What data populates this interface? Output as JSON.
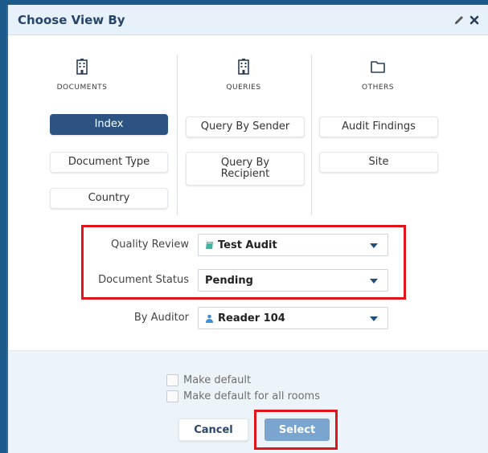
{
  "dialog": {
    "title": "Choose View By",
    "icons": [
      "pencil-icon",
      "close-icon"
    ]
  },
  "categories": [
    {
      "label": "DOCUMENTS",
      "icon": "building-icon",
      "options": [
        {
          "label": "Index",
          "active": true
        },
        {
          "label": "Document Type",
          "active": false
        },
        {
          "label": "Country",
          "active": false
        }
      ]
    },
    {
      "label": "QUERIES",
      "icon": "building-icon",
      "options": [
        {
          "label": "Query By Sender",
          "active": false
        },
        {
          "label": "Query By Recipient",
          "active": false
        }
      ]
    },
    {
      "label": "OTHERS",
      "icon": "folder-icon",
      "options": [
        {
          "label": "Audit Findings",
          "active": false
        },
        {
          "label": "Site",
          "active": false
        }
      ]
    }
  ],
  "filters": {
    "quality_review": {
      "label": "Quality Review",
      "value": "Test Audit",
      "icon": "book-icon"
    },
    "document_status": {
      "label": "Document Status",
      "value": "Pending"
    },
    "by_auditor": {
      "label": "By Auditor",
      "value": "Reader 104",
      "icon": "user-icon"
    }
  },
  "footer": {
    "make_default": "Make default",
    "make_default_all": "Make default for all rooms",
    "cancel_label": "Cancel",
    "select_label": "Select"
  },
  "colors": {
    "background": "#1d5a8c",
    "header": "#e7f1f9",
    "active_option": "#2d5383",
    "select_button": "#7aa5cf",
    "highlight_box": "#e0141b"
  }
}
